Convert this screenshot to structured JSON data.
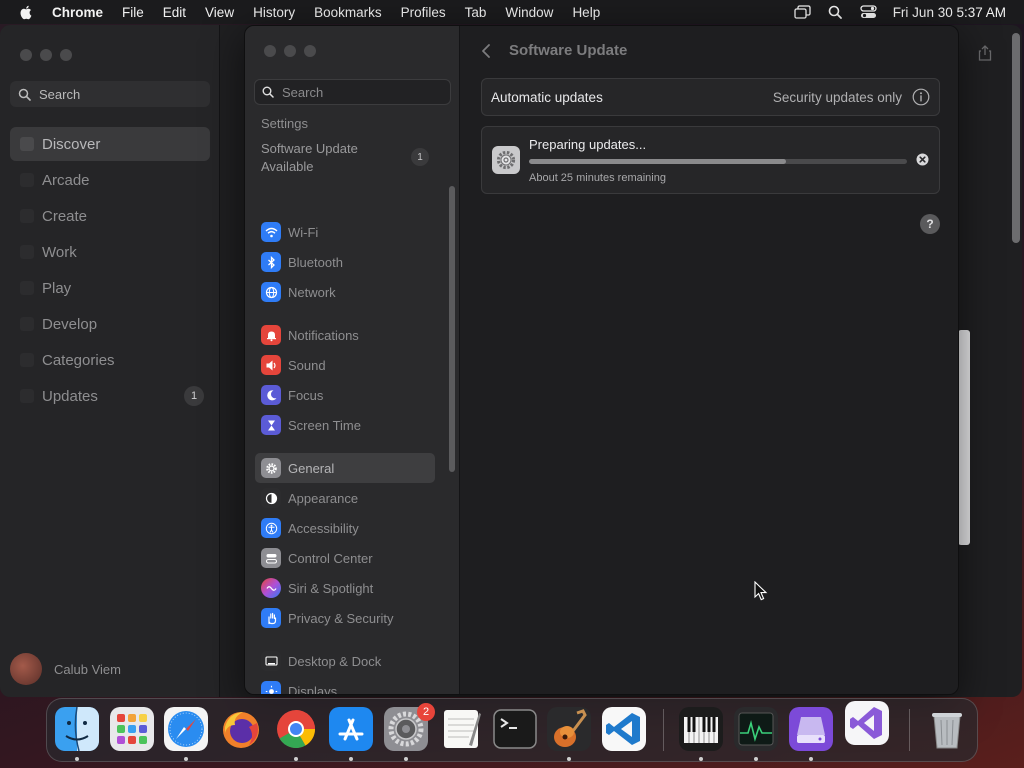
{
  "menubar": {
    "app_name": "Chrome",
    "items": [
      "File",
      "Edit",
      "View",
      "History",
      "Bookmarks",
      "Profiles",
      "Tab",
      "Window",
      "Help"
    ],
    "clock": "Fri Jun 30  5:37 AM"
  },
  "appstore": {
    "search_placeholder": "Search",
    "nav": [
      {
        "label": "Discover"
      },
      {
        "label": "Arcade"
      },
      {
        "label": "Create"
      },
      {
        "label": "Work"
      },
      {
        "label": "Play"
      },
      {
        "label": "Develop"
      },
      {
        "label": "Categories"
      },
      {
        "label": "Updates",
        "badge": "1"
      }
    ],
    "user_name": "Calub Viem"
  },
  "settings": {
    "search_placeholder": "Search",
    "partial_item": "Settings",
    "update_available_label": "Software Update Available",
    "update_available_badge": "1",
    "sidebar": [
      {
        "label": "Wi-Fi",
        "icon": "wifi-icon",
        "color": "#2f7cf6"
      },
      {
        "label": "Bluetooth",
        "icon": "bluetooth-icon",
        "color": "#2f7cf6"
      },
      {
        "label": "Network",
        "icon": "globe-icon",
        "color": "#2f7cf6"
      },
      {
        "label": "Notifications",
        "icon": "bell-icon",
        "color": "#e5453b"
      },
      {
        "label": "Sound",
        "icon": "speaker-icon",
        "color": "#e5453b"
      },
      {
        "label": "Focus",
        "icon": "moon-icon",
        "color": "#5b5bd6"
      },
      {
        "label": "Screen Time",
        "icon": "hourglass-icon",
        "color": "#5b5bd6"
      },
      {
        "label": "General",
        "icon": "gear-icon",
        "color": "#8e8e93"
      },
      {
        "label": "Appearance",
        "icon": "appearance-icon",
        "color": "#2c2c2e"
      },
      {
        "label": "Accessibility",
        "icon": "accessibility-icon",
        "color": "#2f7cf6"
      },
      {
        "label": "Control Center",
        "icon": "control-center-icon",
        "color": "#8e8e93"
      },
      {
        "label": "Siri & Spotlight",
        "icon": "siri-icon",
        "color": "#b04fd6"
      },
      {
        "label": "Privacy & Security",
        "icon": "hand-icon",
        "color": "#2f7cf6"
      },
      {
        "label": "Desktop & Dock",
        "icon": "desktop-icon",
        "color": "#2c2c2e"
      },
      {
        "label": "Displays",
        "icon": "displays-icon",
        "color": "#2f7cf6"
      }
    ],
    "content": {
      "title": "Software Update",
      "automatic_updates_label": "Automatic updates",
      "automatic_updates_value": "Security updates only",
      "preparing_title": "Preparing updates...",
      "progress_fraction": 0.68,
      "remaining_text": "About 25 minutes remaining",
      "help_label": "?"
    }
  },
  "dock": {
    "settings_badge": "2",
    "apps": [
      {
        "name": "finder-icon"
      },
      {
        "name": "launchpad-icon"
      },
      {
        "name": "safari-icon"
      },
      {
        "name": "firefox-icon"
      },
      {
        "name": "chrome-icon"
      },
      {
        "name": "app-store-icon"
      },
      {
        "name": "system-settings-icon"
      },
      {
        "name": "textedit-icon"
      },
      {
        "name": "terminal-icon"
      },
      {
        "name": "garageband-icon"
      },
      {
        "name": "vscode-icon"
      },
      {
        "name": "piano-icon"
      },
      {
        "name": "activity-monitor-icon"
      },
      {
        "name": "disk-utility-icon"
      },
      {
        "name": "visual-studio-icon"
      },
      {
        "name": "trash-icon"
      }
    ]
  }
}
